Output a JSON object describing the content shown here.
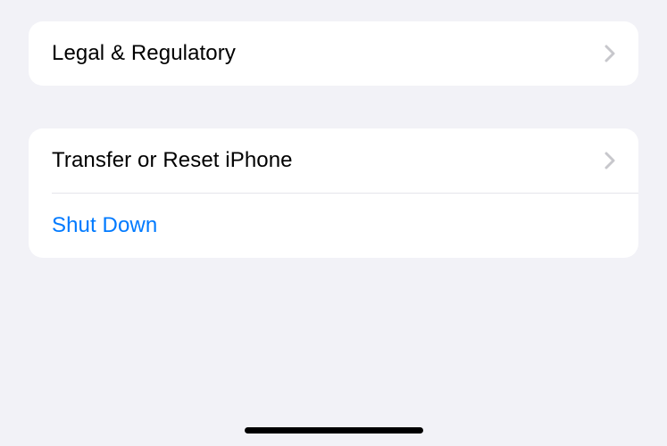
{
  "groups": [
    {
      "items": [
        {
          "label": "Legal & Regulatory",
          "has_chevron": true,
          "is_link": false
        }
      ]
    },
    {
      "items": [
        {
          "label": "Transfer or Reset iPhone",
          "has_chevron": true,
          "is_link": false
        },
        {
          "label": "Shut Down",
          "has_chevron": false,
          "is_link": true
        }
      ]
    }
  ],
  "colors": {
    "background": "#f2f2f7",
    "card": "#ffffff",
    "text": "#000000",
    "link": "#007aff",
    "chevron": "#c7c7cc",
    "divider": "#e5e5ea"
  }
}
